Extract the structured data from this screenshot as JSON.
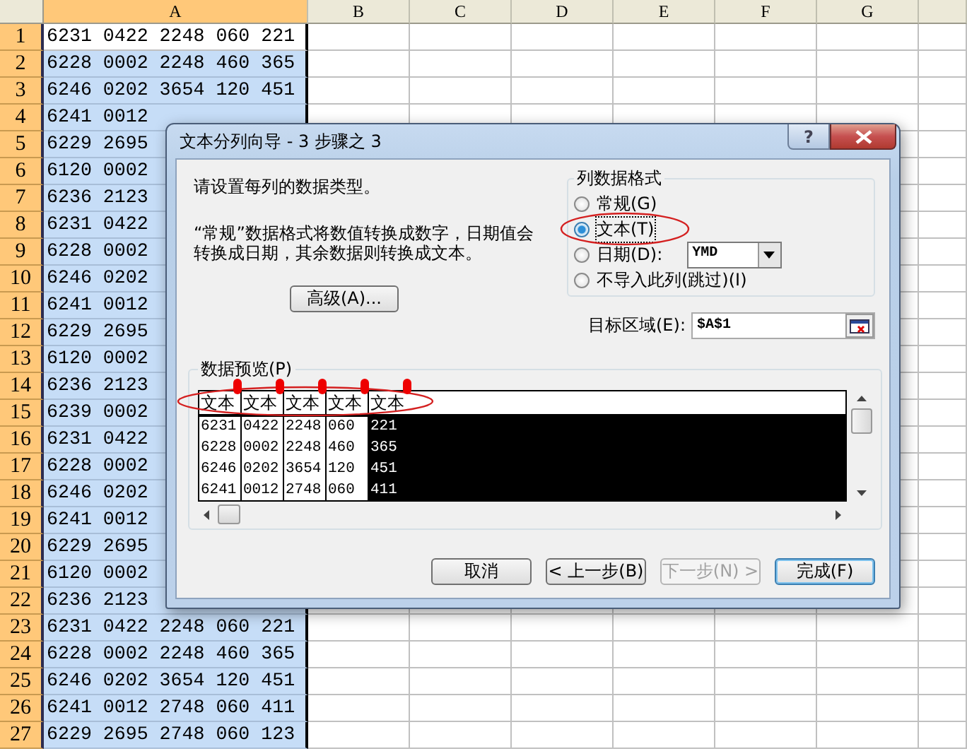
{
  "spreadsheet": {
    "columns": [
      {
        "label": "A",
        "selected": true
      },
      {
        "label": "B",
        "selected": false
      },
      {
        "label": "C",
        "selected": false
      },
      {
        "label": "D",
        "selected": false
      },
      {
        "label": "E",
        "selected": false
      },
      {
        "label": "F",
        "selected": false
      },
      {
        "label": "G",
        "selected": false
      }
    ],
    "rows": [
      {
        "number": "1",
        "value": "6231 0422 2248 060 221",
        "selected": true,
        "active": true
      },
      {
        "number": "2",
        "value": "6228 0002 2248 460 365",
        "selected": true,
        "active": false
      },
      {
        "number": "3",
        "value": "6246 0202 3654 120 451",
        "selected": true,
        "active": false
      },
      {
        "number": "4",
        "value": "6241 0012",
        "selected": true,
        "active": false
      },
      {
        "number": "5",
        "value": "6229 2695",
        "selected": true,
        "active": false
      },
      {
        "number": "6",
        "value": "6120 0002",
        "selected": true,
        "active": false
      },
      {
        "number": "7",
        "value": "6236 2123",
        "selected": true,
        "active": false
      },
      {
        "number": "8",
        "value": "6231 0422",
        "selected": true,
        "active": false
      },
      {
        "number": "9",
        "value": "6228 0002",
        "selected": true,
        "active": false
      },
      {
        "number": "10",
        "value": "6246 0202",
        "selected": true,
        "active": false
      },
      {
        "number": "11",
        "value": "6241 0012",
        "selected": true,
        "active": false
      },
      {
        "number": "12",
        "value": "6229 2695",
        "selected": true,
        "active": false
      },
      {
        "number": "13",
        "value": "6120 0002",
        "selected": true,
        "active": false
      },
      {
        "number": "14",
        "value": "6236 2123",
        "selected": true,
        "active": false
      },
      {
        "number": "15",
        "value": "6239 0002",
        "selected": true,
        "active": false
      },
      {
        "number": "16",
        "value": "6231 0422",
        "selected": true,
        "active": false
      },
      {
        "number": "17",
        "value": "6228 0002",
        "selected": true,
        "active": false
      },
      {
        "number": "18",
        "value": "6246 0202",
        "selected": true,
        "active": false
      },
      {
        "number": "19",
        "value": "6241 0012",
        "selected": true,
        "active": false
      },
      {
        "number": "20",
        "value": "6229 2695",
        "selected": true,
        "active": false
      },
      {
        "number": "21",
        "value": "6120 0002",
        "selected": true,
        "active": false
      },
      {
        "number": "22",
        "value": "6236 2123",
        "selected": true,
        "active": false
      },
      {
        "number": "23",
        "value": "6231 0422 2248 060 221",
        "selected": true,
        "active": false
      },
      {
        "number": "24",
        "value": "6228 0002 2248 460 365",
        "selected": true,
        "active": false
      },
      {
        "number": "25",
        "value": "6246 0202 3654 120 451",
        "selected": true,
        "active": false
      },
      {
        "number": "26",
        "value": "6241 0012 2748 060 411",
        "selected": true,
        "active": false
      },
      {
        "number": "27",
        "value": "6229 2695 2748 060 123",
        "selected": true,
        "active": false
      }
    ]
  },
  "dialog": {
    "title": "文本分列向导 - 3 步骤之 3",
    "help_button": "?",
    "instruction": "请设置每列的数据类型。",
    "description": "“常规”数据格式将数值转换成数字，日期值会转换成日期，其余数据则转换成文本。",
    "advanced_button": "高级(A)...",
    "column_format": {
      "title": "列数据格式",
      "options": [
        {
          "label": "常规(G)",
          "selected": false
        },
        {
          "label": "文本(T)",
          "selected": true
        },
        {
          "label": "日期(D):",
          "selected": false,
          "dropdown": "YMD"
        },
        {
          "label": "不导入此列(跳过)(I)",
          "selected": false
        }
      ]
    },
    "destination": {
      "label": "目标区域(E):",
      "value": "$A$1"
    },
    "preview": {
      "title": "数据预览(P)",
      "columns": [
        {
          "header": "文本",
          "values": [
            "6231",
            "6228",
            "6246",
            "6241"
          ],
          "selected": false
        },
        {
          "header": "文本",
          "values": [
            "0422",
            "0002",
            "0202",
            "0012"
          ],
          "selected": false
        },
        {
          "header": "文本",
          "values": [
            "2248",
            "2248",
            "3654",
            "2748"
          ],
          "selected": false
        },
        {
          "header": "文本",
          "values": [
            "060",
            "460",
            "120",
            "060"
          ],
          "selected": false
        },
        {
          "header": "文本",
          "values": [
            "221",
            "365",
            "451",
            "411"
          ],
          "selected": true
        }
      ]
    },
    "buttons": [
      {
        "label": "取消",
        "disabled": false,
        "default": false
      },
      {
        "label": "< 上一步(B)",
        "disabled": false,
        "default": false
      },
      {
        "label": "下一步(N) >",
        "disabled": true,
        "default": false
      },
      {
        "label": "完成(F)",
        "disabled": false,
        "default": true
      }
    ]
  }
}
